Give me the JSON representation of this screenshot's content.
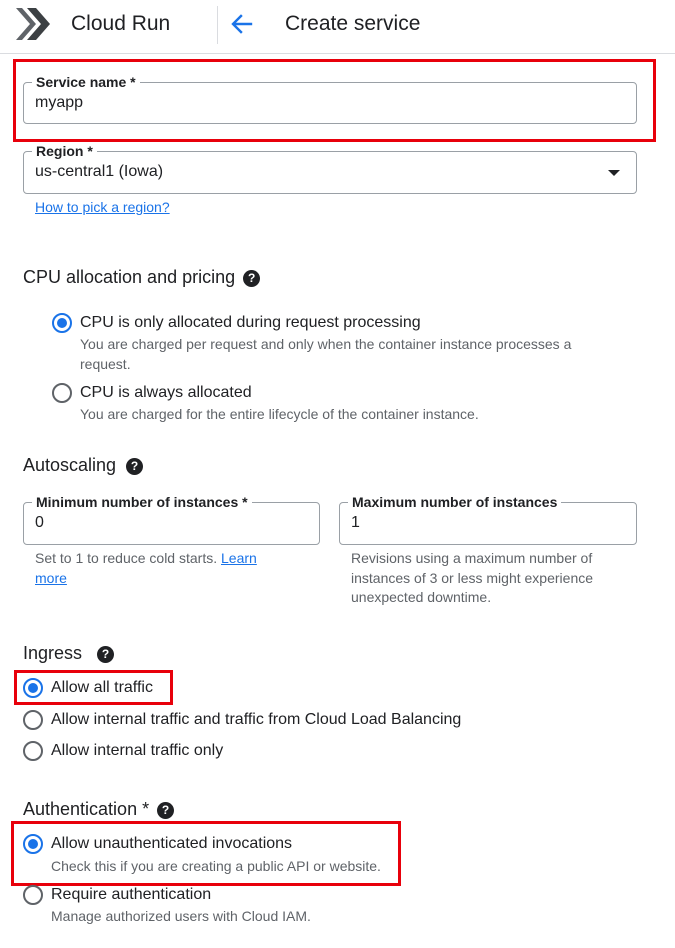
{
  "header": {
    "product": "Cloud Run",
    "title": "Create service"
  },
  "service_name": {
    "label": "Service name *",
    "value": "myapp"
  },
  "region": {
    "label": "Region *",
    "value": "us-central1 (Iowa)",
    "help_link": "How to pick a region?"
  },
  "cpu": {
    "title": "CPU allocation and pricing",
    "options": [
      {
        "label": "CPU is only allocated during request processing",
        "desc": "You are charged per request and only when the container instance processes a request.",
        "checked": true
      },
      {
        "label": "CPU is always allocated",
        "desc": "You are charged for the entire lifecycle of the container instance.",
        "checked": false
      }
    ]
  },
  "autoscaling": {
    "title": "Autoscaling",
    "min": {
      "label": "Minimum number of instances *",
      "value": "0",
      "helper": "Set to 1 to reduce cold starts.",
      "link": "Learn more"
    },
    "max": {
      "label": "Maximum number of instances",
      "value": "1",
      "helper": "Revisions using a maximum number of instances of 3 or less might experience unexpected downtime."
    }
  },
  "ingress": {
    "title": "Ingress",
    "options": [
      {
        "label": "Allow all traffic",
        "checked": true
      },
      {
        "label": "Allow internal traffic and traffic from Cloud Load Balancing",
        "checked": false
      },
      {
        "label": "Allow internal traffic only",
        "checked": false
      }
    ]
  },
  "authentication": {
    "title": "Authentication *",
    "options": [
      {
        "label": "Allow unauthenticated invocations",
        "desc": "Check this if you are creating a public API or website.",
        "checked": true
      },
      {
        "label": "Require authentication",
        "desc": "Manage authorized users with Cloud IAM.",
        "checked": false
      }
    ]
  },
  "icons": {
    "logo": "cloud-run-logo-icon",
    "back": "arrow-back-icon",
    "help": "help-circle-icon",
    "dropdown": "dropdown-arrow-icon"
  },
  "colors": {
    "accent": "#1a73e8",
    "highlight": "#e8000b",
    "text": "#202124",
    "secondary_text": "#5f6368"
  }
}
